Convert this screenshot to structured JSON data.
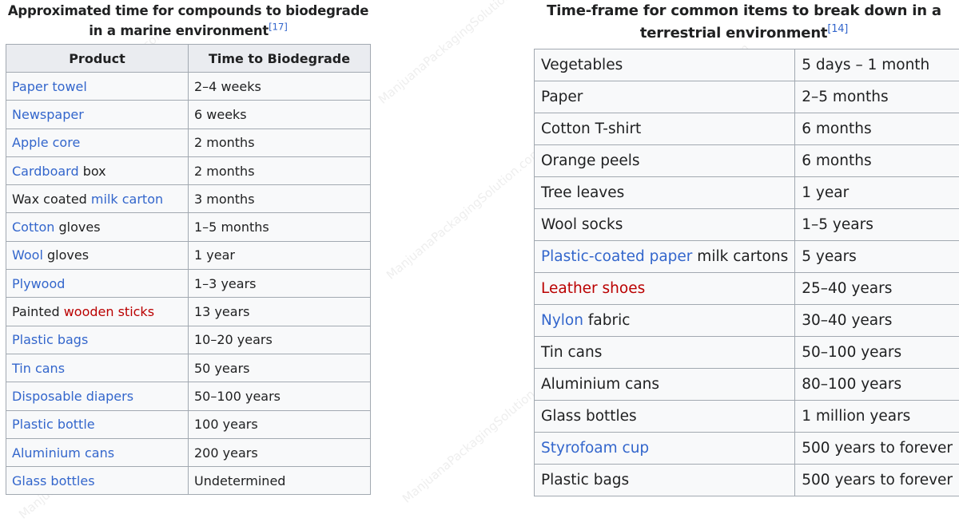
{
  "watermark": "ManjuanaPackagingSolution.com",
  "colors": {
    "link": "#3366cc",
    "redlink": "#ba0000",
    "text": "#202122",
    "border": "#a2a9b1",
    "header_bg": "#eaecf0",
    "cell_bg": "#f8f9fa"
  },
  "marine": {
    "caption": "Approximated time for compounds to biodegrade in a marine environment",
    "citation": "[17]",
    "headers": [
      "Product",
      "Time to Biodegrade"
    ],
    "rows": [
      {
        "product": [
          {
            "text": "Paper towel",
            "type": "link"
          }
        ],
        "time": "2–4 weeks"
      },
      {
        "product": [
          {
            "text": "Newspaper",
            "type": "link"
          }
        ],
        "time": "6 weeks"
      },
      {
        "product": [
          {
            "text": "Apple core",
            "type": "link"
          }
        ],
        "time": "2 months"
      },
      {
        "product": [
          {
            "text": "Cardboard",
            "type": "link"
          },
          {
            "text": " box",
            "type": "text"
          }
        ],
        "time": "2 months"
      },
      {
        "product": [
          {
            "text": "Wax coated ",
            "type": "text"
          },
          {
            "text": "milk carton",
            "type": "link"
          }
        ],
        "time": "3 months"
      },
      {
        "product": [
          {
            "text": "Cotton",
            "type": "link"
          },
          {
            "text": " gloves",
            "type": "text"
          }
        ],
        "time": "1–5 months"
      },
      {
        "product": [
          {
            "text": "Wool",
            "type": "link"
          },
          {
            "text": " gloves",
            "type": "text"
          }
        ],
        "time": "1 year"
      },
      {
        "product": [
          {
            "text": "Plywood",
            "type": "link"
          }
        ],
        "time": "1–3 years"
      },
      {
        "product": [
          {
            "text": "Painted ",
            "type": "text"
          },
          {
            "text": "wooden sticks",
            "type": "redlink"
          }
        ],
        "time": "13 years"
      },
      {
        "product": [
          {
            "text": "Plastic bags",
            "type": "link"
          }
        ],
        "time": "10–20 years"
      },
      {
        "product": [
          {
            "text": "Tin cans",
            "type": "link"
          }
        ],
        "time": "50 years"
      },
      {
        "product": [
          {
            "text": "Disposable diapers",
            "type": "link"
          }
        ],
        "time": "50–100 years"
      },
      {
        "product": [
          {
            "text": "Plastic bottle",
            "type": "link"
          }
        ],
        "time": "100 years"
      },
      {
        "product": [
          {
            "text": "Aluminium cans",
            "type": "link"
          }
        ],
        "time": "200 years"
      },
      {
        "product": [
          {
            "text": "Glass bottles",
            "type": "link"
          }
        ],
        "time": "Undetermined"
      }
    ]
  },
  "terrestrial": {
    "caption": "Time-frame for common items to break down in a terrestrial environment",
    "citation": "[14]",
    "rows": [
      {
        "item": [
          {
            "text": "Vegetables",
            "type": "text"
          }
        ],
        "time": "5 days – 1 month"
      },
      {
        "item": [
          {
            "text": "Paper",
            "type": "text"
          }
        ],
        "time": "2–5 months"
      },
      {
        "item": [
          {
            "text": "Cotton T-shirt",
            "type": "text"
          }
        ],
        "time": "6 months"
      },
      {
        "item": [
          {
            "text": "Orange peels",
            "type": "text"
          }
        ],
        "time": "6 months"
      },
      {
        "item": [
          {
            "text": "Tree leaves",
            "type": "text"
          }
        ],
        "time": "1 year"
      },
      {
        "item": [
          {
            "text": "Wool socks",
            "type": "text"
          }
        ],
        "time": "1–5 years"
      },
      {
        "item": [
          {
            "text": "Plastic-coated paper",
            "type": "link"
          },
          {
            "text": " milk cartons",
            "type": "text"
          }
        ],
        "time": "5 years"
      },
      {
        "item": [
          {
            "text": "Leather shoes",
            "type": "redlink"
          }
        ],
        "time": "25–40 years"
      },
      {
        "item": [
          {
            "text": "Nylon",
            "type": "link"
          },
          {
            "text": " fabric",
            "type": "text"
          }
        ],
        "time": "30–40 years"
      },
      {
        "item": [
          {
            "text": "Tin cans",
            "type": "text"
          }
        ],
        "time": "50–100 years"
      },
      {
        "item": [
          {
            "text": "Aluminium cans",
            "type": "text"
          }
        ],
        "time": "80–100 years"
      },
      {
        "item": [
          {
            "text": "Glass bottles",
            "type": "text"
          }
        ],
        "time": "1 million years"
      },
      {
        "item": [
          {
            "text": "Styrofoam cup",
            "type": "link"
          }
        ],
        "time": "500 years to forever"
      },
      {
        "item": [
          {
            "text": "Plastic bags",
            "type": "text"
          }
        ],
        "time": "500 years to forever"
      }
    ]
  }
}
